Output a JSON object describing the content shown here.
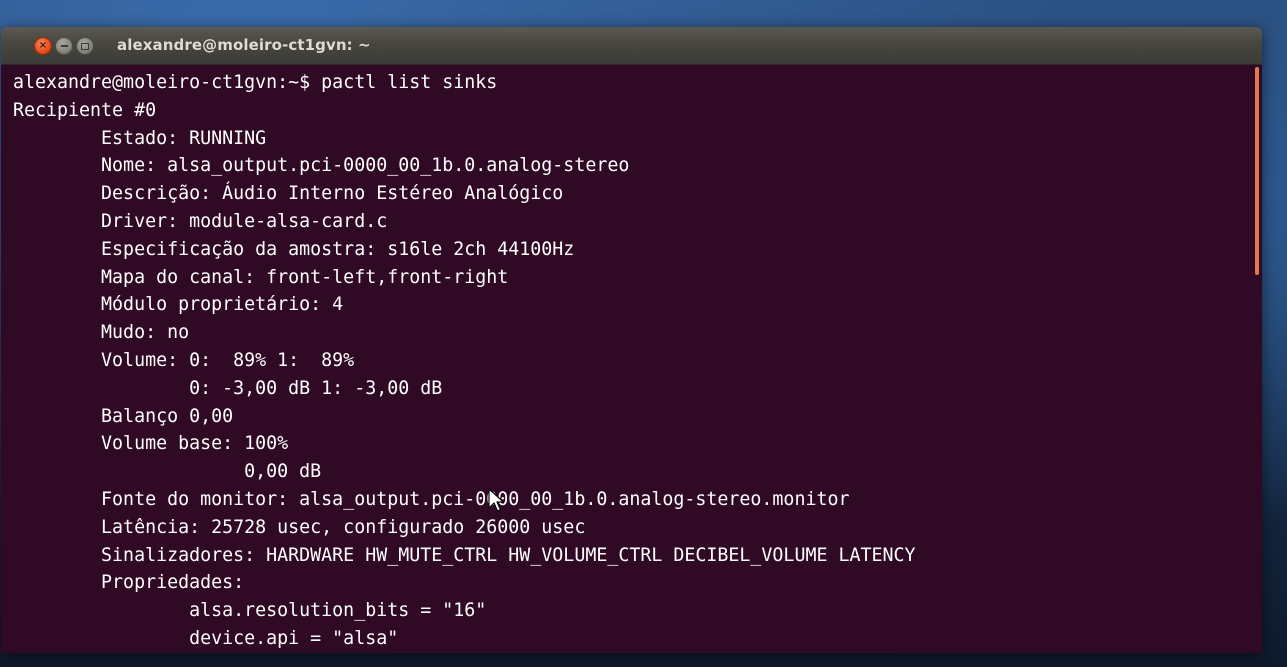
{
  "window": {
    "title": "alexandre@moleiro-ct1gvn: ~",
    "buttons": {
      "close_icon": "close-icon",
      "minimize_icon": "minimize-icon",
      "maximize_icon": "maximize-icon"
    }
  },
  "terminal": {
    "lines": [
      "alexandre@moleiro-ct1gvn:~$ pactl list sinks",
      "Recipiente #0",
      "        Estado: RUNNING",
      "        Nome: alsa_output.pci-0000_00_1b.0.analog-stereo",
      "        Descrição: Áudio Interno Estéreo Analógico",
      "        Driver: module-alsa-card.c",
      "        Especificação da amostra: s16le 2ch 44100Hz",
      "        Mapa do canal: front-left,front-right",
      "        Módulo proprietário: 4",
      "        Mudo: no",
      "        Volume: 0:  89% 1:  89%",
      "                0: -3,00 dB 1: -3,00 dB",
      "        Balanço 0,00",
      "        Volume base: 100%",
      "                     0,00 dB",
      "        Fonte do monitor: alsa_output.pci-0000_00_1b.0.analog-stereo.monitor",
      "        Latência: 25728 usec, configurado 26000 usec",
      "        Sinalizadores: HARDWARE HW_MUTE_CTRL HW_VOLUME_CTRL DECIBEL_VOLUME LATENCY",
      "        Propriedades:",
      "                alsa.resolution_bits = \"16\"",
      "                device.api = \"alsa\""
    ]
  },
  "colors": {
    "terminal_background": "#300a24",
    "terminal_foreground": "#ffffff",
    "titlebar": "#3c3b37",
    "close_button": "#e5521f",
    "scrollbar_thumb": "#e07a4a"
  }
}
